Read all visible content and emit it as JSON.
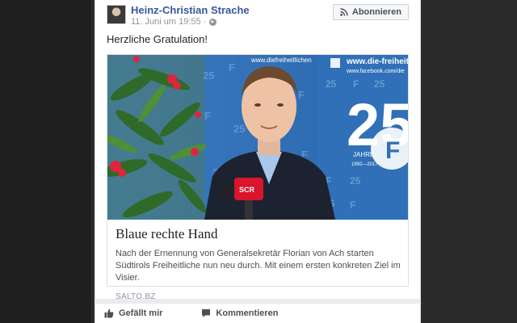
{
  "post": {
    "author": "Heinz-Christian Strache",
    "timestamp": "11. Juni um 19:55 ·",
    "privacy_icon": "globe-icon",
    "follow_label": "Abonnieren",
    "follow_icon": "rss-icon",
    "text": "Herzliche Gratulation!"
  },
  "link_preview": {
    "title": "Blaue rechte Hand",
    "description": "Nach der Ernennung von Generalsekretär Florian von Ach starten Südtirols Freiheitliche nun neu durch. Mit einem ersten konkreten Ziel im Visier.",
    "source": "SALTO.BZ",
    "image": {
      "banner_url_text": "www.die-freiheit",
      "banner_fb_text": "www.facebook.com/die",
      "backdrop_url_text": "www.diefreiheitlichen",
      "anniversary_number": "25",
      "anniversary_word": "JAHRE",
      "anniversary_years": "1992—2017",
      "mic_label": "SCR"
    }
  },
  "actions": {
    "like_label": "Gefällt mir",
    "like_icon": "thumbs-up-icon",
    "comment_label": "Kommentieren",
    "comment_icon": "comment-icon"
  },
  "colors": {
    "author_link": "#365899",
    "backdrop_blue": "#2f6db0"
  }
}
